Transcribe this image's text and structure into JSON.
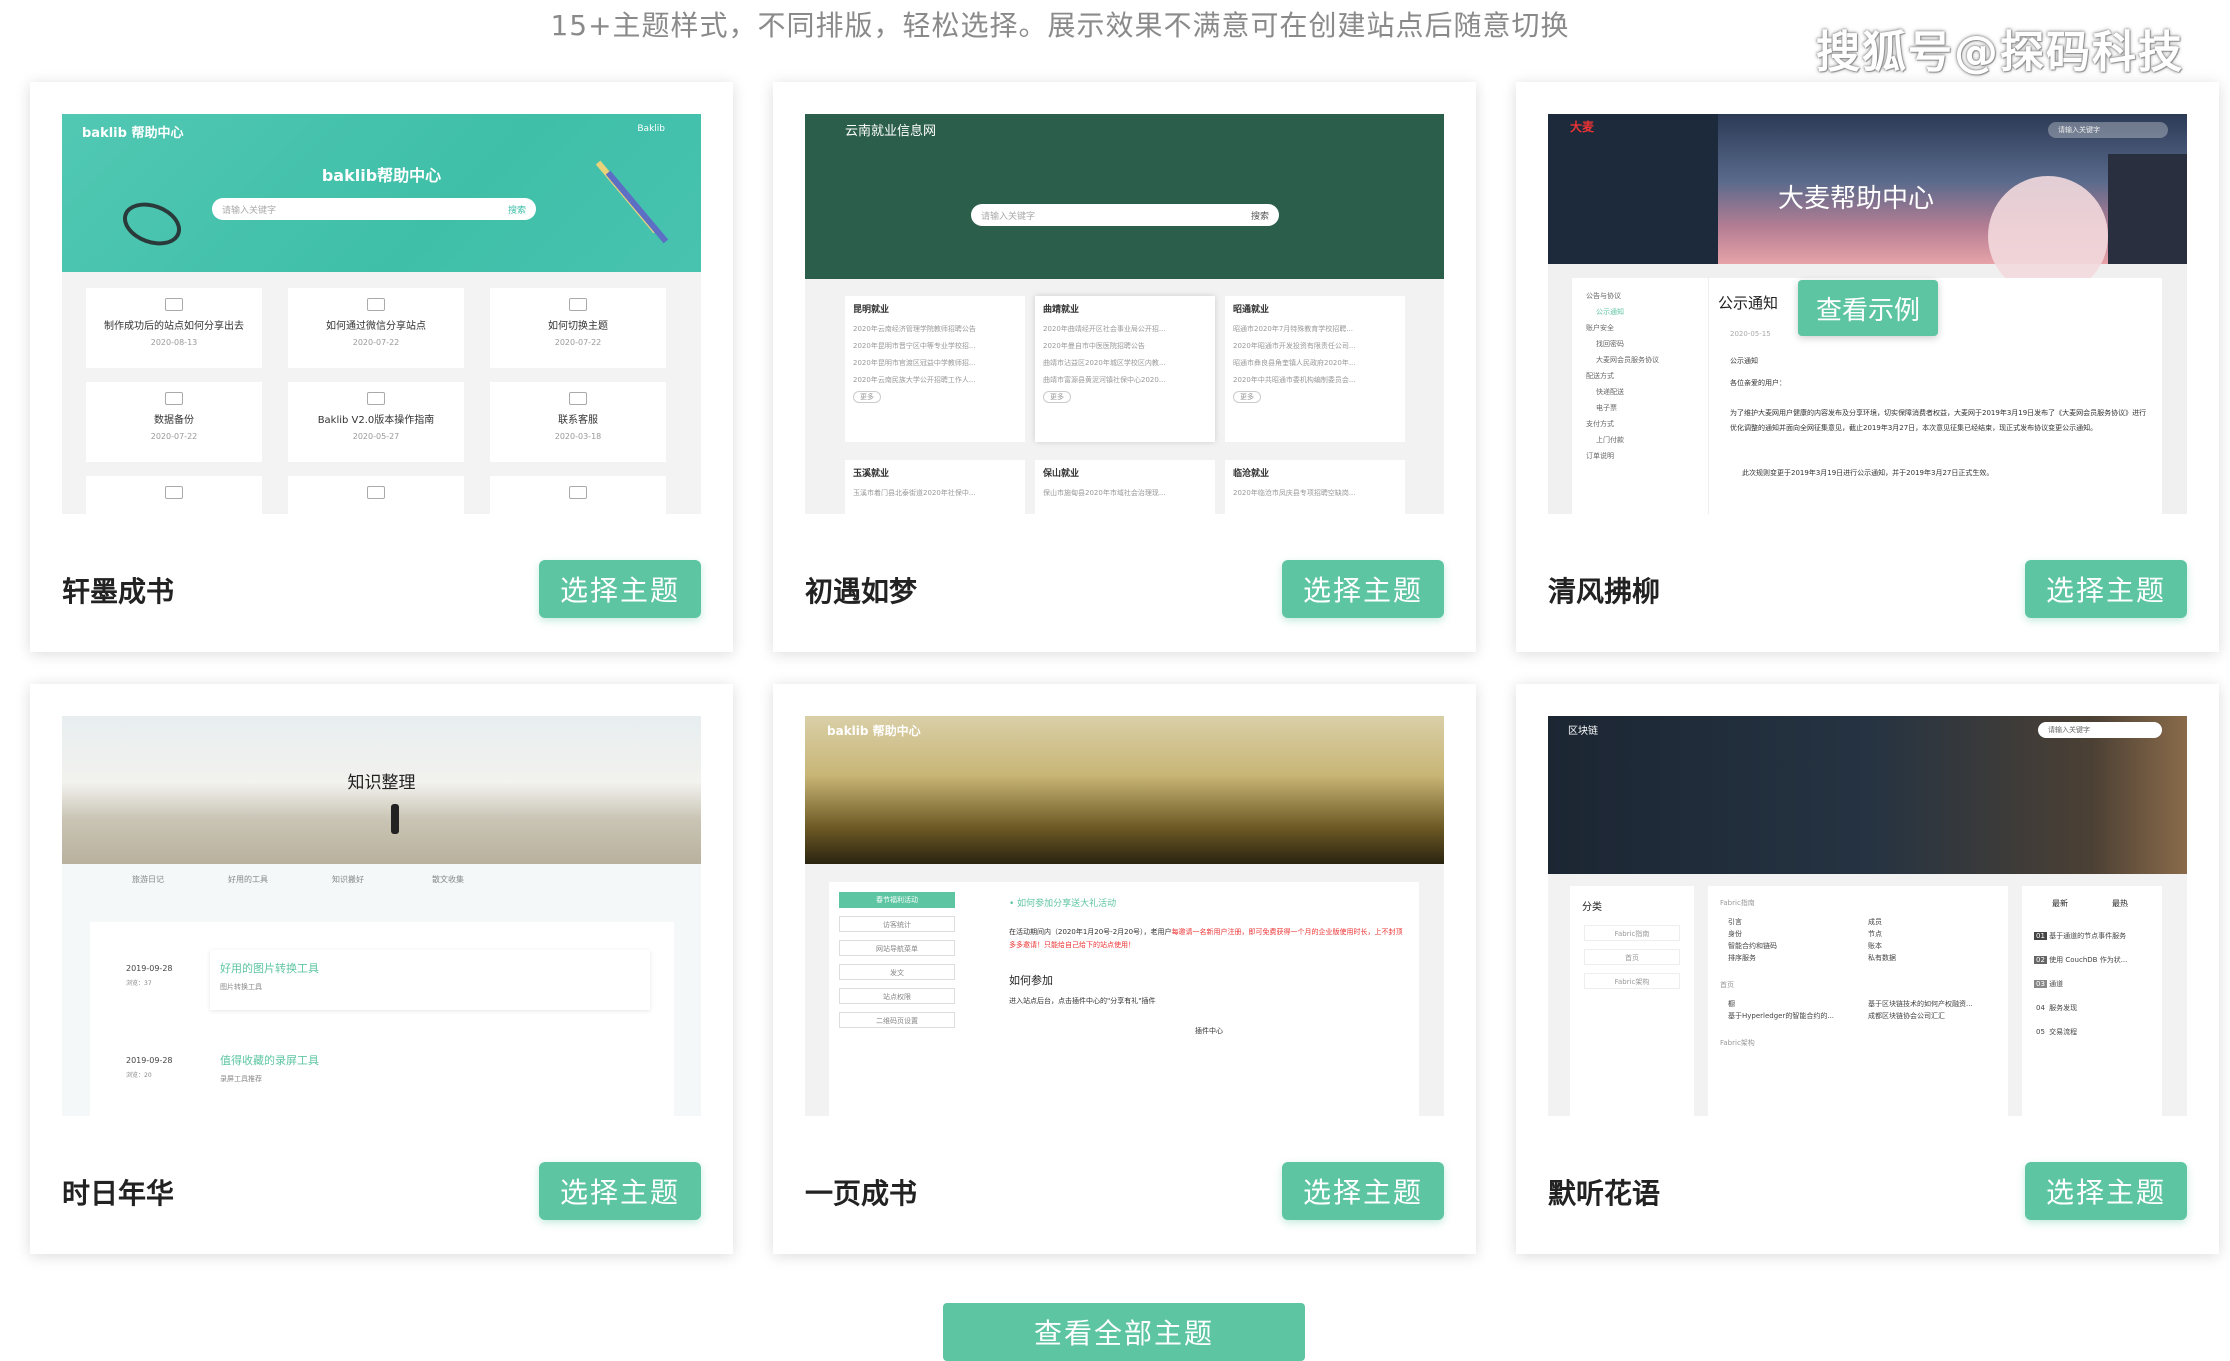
{
  "header": {
    "subtitle": "15+主题样式，不同排版，轻松选择。展示效果不满意可在创建站点后随意切换",
    "watermark": "搜狐号@探码科技"
  },
  "select_label": "选择主题",
  "preview_overlay": "查看示例",
  "view_all_label": "查看全部主题",
  "themes": [
    {
      "name": "轩墨成书",
      "preview": {
        "logo": "baklib 帮助中心",
        "top_right": "Baklib",
        "title": "baklib帮助中心",
        "search_placeholder": "请输入关键字",
        "search_btn": "搜索",
        "tiles": [
          {
            "title": "制作成功后的站点如何分享出去",
            "date": "2020-08-13"
          },
          {
            "title": "如何通过微信分享站点",
            "date": "2020-07-22"
          },
          {
            "title": "如何切换主题",
            "date": "2020-07-22"
          },
          {
            "title": "数据备份",
            "date": "2020-07-22"
          },
          {
            "title": "Baklib V2.0版本操作指南",
            "date": "2020-05-27"
          },
          {
            "title": "联系客服",
            "date": "2020-03-18"
          }
        ]
      }
    },
    {
      "name": "初遇如梦",
      "preview": {
        "logo": "云南就业信息网",
        "search_placeholder": "请输入关键字",
        "search_btn": "搜索",
        "cols": [
          {
            "h": "昆明就业",
            "items": [
              "2020年云南经济管理学院教师招聘公告",
              "2020年昆明市晋宁区中等专业学校招...",
              "2020年昆明市官渡区冠益中学教师招...",
              "2020年云南民族大学公开招聘工作人..."
            ]
          },
          {
            "h": "曲靖就业",
            "items": [
              "2020年曲靖经开区社会事业局公开招...",
              "2020年曼自市中医医院招聘公告",
              "曲靖市沾益区2020年城区学校区内教...",
              "曲靖市富源县黄泥河镇社保中心2020..."
            ]
          },
          {
            "h": "昭通就业",
            "items": [
              "昭通市2020年7月特殊教育学校招聘...",
              "2020年昭通市开发投资有限责任公司...",
              "昭通市彝良县角奎镇人民政府2020年...",
              "2020年中共昭通市委机构编制委员会..."
            ]
          }
        ],
        "more": "更多",
        "cols2": [
          {
            "h": "玉溪就业",
            "item": "玉溪市着门县北泰街道2020年社保中..."
          },
          {
            "h": "保山就业",
            "item": "保山市施甸县2020年市域社会治理现..."
          },
          {
            "h": "临沧就业",
            "item": "2020年临沧市凤庆县专项招聘空缺岗..."
          }
        ]
      }
    },
    {
      "name": "清风拂柳",
      "preview": {
        "logo": "大麦",
        "search_placeholder": "请输入关键字",
        "title": "大麦帮助中心",
        "side": [
          "公告与协议",
          "公示通知",
          "账户安全",
          "找回密码",
          "大麦网会员服务协议",
          "配送方式",
          "快递配送",
          "电子票",
          "支付方式",
          "上门付款",
          "订单说明"
        ],
        "heading": "公示通知",
        "date": "2020-05-15",
        "p1": "公示通知",
        "p2": "各位亲爱的用户：",
        "p3": "为了维护大麦网用户健康的内容发布及分享环境，切实保障消费者权益，大麦网于2019年3月19日发布了《大麦网会员服务协议》进行优化调整的通知并面向全网征集意见，截止2019年3月27日，本次意见征集已经结束，现正式发布协议变更公示通知。",
        "p4": "此次规则变更于2019年3月19日进行公示通知，并于2019年3月27日正式生效。"
      }
    },
    {
      "name": "时日年华",
      "preview": {
        "title": "知识整理",
        "tabs": [
          "旅游日记",
          "好用的工具",
          "知识搬好",
          "散文收集"
        ],
        "entries": [
          {
            "date": "2019-09-28",
            "views": "浏览：37",
            "title": "好用的图片转换工具",
            "sub": "图片转换工具"
          },
          {
            "date": "2019-09-28",
            "views": "浏览：20",
            "title": "值得收藏的录屏工具",
            "sub": "录屏工具推荐"
          }
        ]
      }
    },
    {
      "name": "一页成书",
      "preview": {
        "logo": "baklib 帮助中心",
        "side": [
          "春节福利活动",
          "访客统计",
          "网站导航菜单",
          "发文",
          "站点权限",
          "二维码页设置"
        ],
        "link": "• 如何参加分享送大礼活动",
        "p1": "在活动期间内（2020年1月20号-2月20号），老用户",
        "p1b": "每邀请一名新用户注册，即可免费获得一个月的企业版使用时长，上不封顶多多邀请！只能给自己给下的站点使用！",
        "h2": "如何参加",
        "p2": "进入站点后台，点击插件中心的\"分享有礼\"插件",
        "plugin": "插件中心"
      }
    },
    {
      "name": "默听花语",
      "preview": {
        "logo": "区块链",
        "search_placeholder": "请输入关键字",
        "cat": "分类",
        "cat_items": [
          "Fabric指南",
          "首页",
          "Fabric架构"
        ],
        "sec1": "Fabric指南",
        "list_a": [
          "引言",
          "身份",
          "智能合约和链码",
          "排序服务"
        ],
        "list_b": [
          "成员",
          "节点",
          "账本",
          "私有数据"
        ],
        "sec2": "首页",
        "list_c": [
          "橱",
          "基于Hyperledger的智能合约的..."
        ],
        "list_d": [
          "基于区块链技术的如何产权融资...",
          "成都区块链协会公司汇汇"
        ],
        "sec3": "Fabric架构",
        "tabs": [
          "最新",
          "最热"
        ],
        "ranks": [
          "基于通道的节点事件服务",
          "使用 CouchDB 作为状...",
          "通道",
          "服务发现",
          "交易流程"
        ]
      }
    }
  ]
}
